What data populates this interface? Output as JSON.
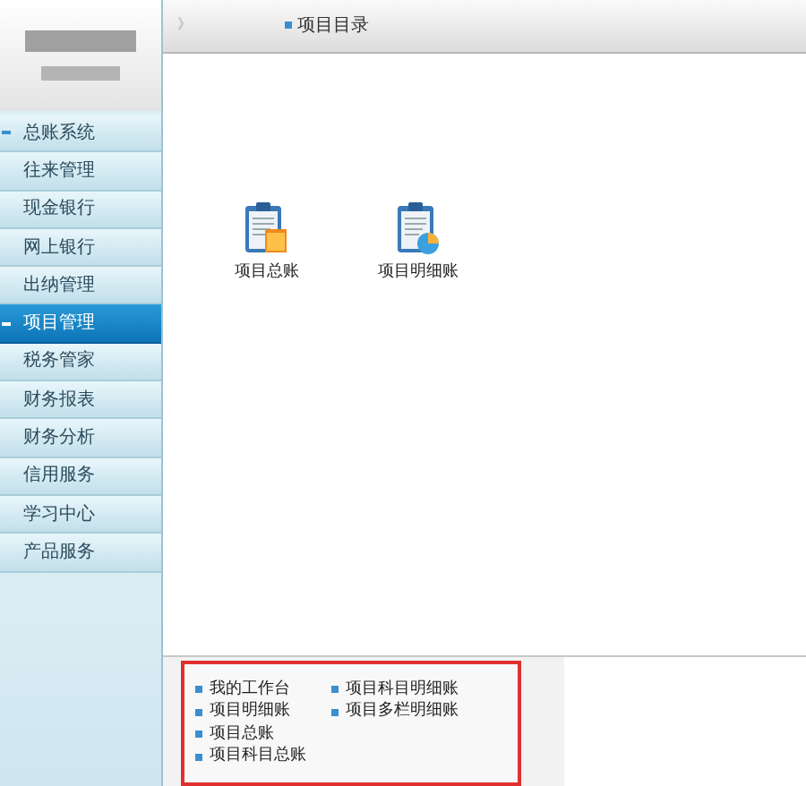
{
  "sidebar": {
    "items": [
      {
        "label": "总账系统",
        "kind": "group",
        "selected": false
      },
      {
        "label": "往来管理",
        "kind": "item",
        "selected": false
      },
      {
        "label": "现金银行",
        "kind": "item",
        "selected": false
      },
      {
        "label": "网上银行",
        "kind": "item",
        "selected": false
      },
      {
        "label": "出纳管理",
        "kind": "item",
        "selected": false
      },
      {
        "label": "项目管理",
        "kind": "group",
        "selected": true
      },
      {
        "label": "税务管家",
        "kind": "item",
        "selected": false
      },
      {
        "label": "财务报表",
        "kind": "item",
        "selected": false
      },
      {
        "label": "财务分析",
        "kind": "item",
        "selected": false
      },
      {
        "label": "信用服务",
        "kind": "item",
        "selected": false
      },
      {
        "label": "学习中心",
        "kind": "item",
        "selected": false
      },
      {
        "label": "产品服务",
        "kind": "item",
        "selected": false
      }
    ]
  },
  "header": {
    "toggle": "》",
    "title": "项目目录"
  },
  "shortcuts": [
    {
      "label": "项目总账",
      "kind": "folder"
    },
    {
      "label": "项目明细账",
      "kind": "chart"
    }
  ],
  "quick_links": {
    "column_1": [
      "我的工作台",
      "项目明细账",
      "项目总账",
      "项目科目总账"
    ],
    "column_2": [
      "项目科目明细账",
      "项目多栏明细账"
    ]
  }
}
